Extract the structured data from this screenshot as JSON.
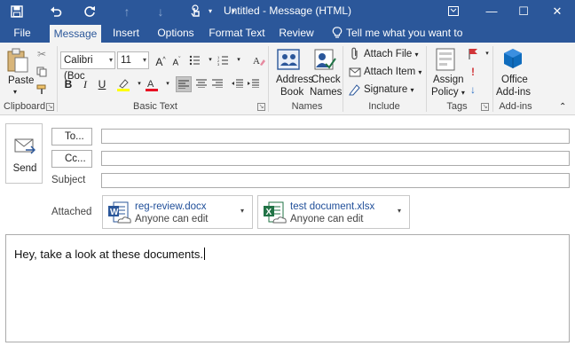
{
  "window": {
    "title": "Untitled - Message (HTML)"
  },
  "titlebar_icons": [
    "save-icon",
    "undo-icon",
    "redo-icon",
    "up-arrow-icon",
    "down-arrow-icon",
    "touch-mode-icon",
    "customize-qat-icon"
  ],
  "window_controls": {
    "restore": "⧉",
    "minimize": "—",
    "maximize": "☐",
    "close": "✕"
  },
  "tabs": [
    {
      "label": "File"
    },
    {
      "label": "Message"
    },
    {
      "label": "Insert"
    },
    {
      "label": "Options"
    },
    {
      "label": "Format Text"
    },
    {
      "label": "Review"
    }
  ],
  "tell_me": "Tell me what you want to do...",
  "ribbon": {
    "clipboard": {
      "label": "Clipboard",
      "paste": "Paste"
    },
    "basic_text": {
      "label": "Basic Text",
      "font": "Calibri (Boc",
      "size": "11",
      "grow": "A",
      "shrink": "A",
      "bold": "B",
      "italic": "I",
      "underline": "U"
    },
    "names": {
      "label": "Names",
      "address_book_1": "Address",
      "address_book_2": "Book",
      "check_names_1": "Check",
      "check_names_2": "Names"
    },
    "include": {
      "label": "Include",
      "attach_file": "Attach File",
      "attach_item": "Attach Item",
      "signature": "Signature"
    },
    "tags": {
      "label": "Tags",
      "assign_policy_1": "Assign",
      "assign_policy_2": "Policy"
    },
    "addins": {
      "label": "Add-ins",
      "office_addins_1": "Office",
      "office_addins_2": "Add-ins"
    }
  },
  "compose": {
    "send": "Send",
    "to_btn": "To...",
    "cc_btn": "Cc...",
    "subject_label": "Subject",
    "to_value": "",
    "cc_value": "",
    "subject_value": "",
    "attached_label": "Attached",
    "attachments": [
      {
        "name": "reg-review.docx",
        "status": "Anyone can edit",
        "type": "word"
      },
      {
        "name": "test document.xlsx",
        "status": "Anyone can edit",
        "type": "excel"
      }
    ],
    "body": "Hey, take a look at these documents."
  },
  "colors": {
    "title_bar": "#2b579a",
    "ribbon_bg": "#f3f3f3",
    "word_blue": "#2b579a",
    "excel_green": "#217346",
    "link_blue": "#1f4e99",
    "flag_red": "#d13438",
    "addins_blue": "#0f6cbd"
  }
}
